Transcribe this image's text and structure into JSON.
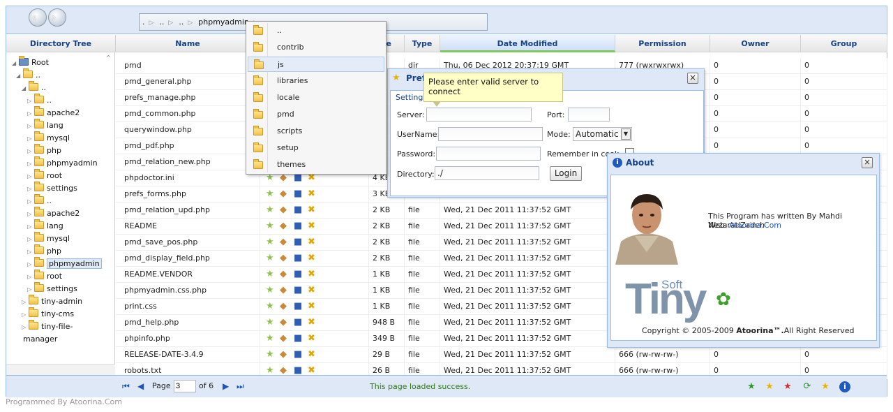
{
  "address": {
    "crumbs": [
      ".",
      "..",
      "..",
      "phpmyadmin"
    ]
  },
  "columns": {
    "tree": "Directory Tree",
    "name": "Name",
    "size": "ze",
    "type": "Type",
    "date": "Date Modified",
    "permission": "Permission",
    "owner": "Owner",
    "group": "Group"
  },
  "tree": [
    {
      "label": "Root",
      "indent": 0
    },
    {
      "label": "..",
      "indent": 1
    },
    {
      "label": "..",
      "indent": 2
    },
    {
      "label": "..",
      "indent": 3
    },
    {
      "label": "apache2",
      "indent": 3
    },
    {
      "label": "lang",
      "indent": 3
    },
    {
      "label": "mysql",
      "indent": 3
    },
    {
      "label": "php",
      "indent": 3
    },
    {
      "label": "phpmyadmin",
      "indent": 3
    },
    {
      "label": "root",
      "indent": 3
    },
    {
      "label": "settings",
      "indent": 3
    },
    {
      "label": "..",
      "indent": 3
    },
    {
      "label": "apache2",
      "indent": 3
    },
    {
      "label": "lang",
      "indent": 3
    },
    {
      "label": "mysql",
      "indent": 3
    },
    {
      "label": "php",
      "indent": 3
    },
    {
      "label": "phpmyadmin",
      "indent": 3,
      "selected": true
    },
    {
      "label": "root",
      "indent": 3
    },
    {
      "label": "settings",
      "indent": 3
    },
    {
      "label": "tiny-admin",
      "indent": 2
    },
    {
      "label": "tiny-cms",
      "indent": 2
    },
    {
      "label": "tiny-file-",
      "indent": 2
    },
    {
      "label": "manager",
      "indent": 1
    }
  ],
  "files": [
    {
      "name": "pmd",
      "size": "",
      "type": "dir",
      "date": "Thu, 06 Dec 2012 20:37:19 GMT",
      "perm": "777 (rwxrwxrwx)",
      "owner": "0",
      "group": "0"
    },
    {
      "name": "pmd_general.php",
      "size": "",
      "type": "",
      "date": "",
      "perm": "",
      "owner": "0",
      "group": "0"
    },
    {
      "name": "prefs_manage.php",
      "size": "",
      "type": "",
      "date": "",
      "perm": "",
      "owner": "0",
      "group": "0"
    },
    {
      "name": "pmd_common.php",
      "size": "",
      "type": "",
      "date": "",
      "perm": "",
      "owner": "0",
      "group": "0"
    },
    {
      "name": "querywindow.php",
      "size": "",
      "type": "",
      "date": "",
      "perm": "",
      "owner": "0",
      "group": "0"
    },
    {
      "name": "pmd_pdf.php",
      "size": "",
      "type": "",
      "date": "",
      "perm": "",
      "owner": "0",
      "group": "0"
    },
    {
      "name": "pmd_relation_new.php",
      "size": "",
      "type": "",
      "date": "",
      "perm": "",
      "owner": "",
      "group": ""
    },
    {
      "name": "phpdoctor.ini",
      "size": "4 KB",
      "type": "",
      "date": "",
      "perm": "",
      "owner": "",
      "group": ""
    },
    {
      "name": "prefs_forms.php",
      "size": "3 KB",
      "type": "",
      "date": "",
      "perm": "",
      "owner": "",
      "group": ""
    },
    {
      "name": "pmd_relation_upd.php",
      "size": "2 KB",
      "type": "file",
      "date": "Wed, 21 Dec 2011 11:37:52 GMT",
      "perm": "",
      "owner": "",
      "group": ""
    },
    {
      "name": "README",
      "size": "2 KB",
      "type": "file",
      "date": "Wed, 21 Dec 2011 11:37:52 GMT",
      "perm": "",
      "owner": "",
      "group": ""
    },
    {
      "name": "pmd_save_pos.php",
      "size": "2 KB",
      "type": "file",
      "date": "Wed, 21 Dec 2011 11:37:52 GMT",
      "perm": "",
      "owner": "",
      "group": ""
    },
    {
      "name": "pmd_display_field.php",
      "size": "2 KB",
      "type": "file",
      "date": "Wed, 21 Dec 2011 11:37:52 GMT",
      "perm": "",
      "owner": "",
      "group": ""
    },
    {
      "name": "README.VENDOR",
      "size": "1 KB",
      "type": "file",
      "date": "Wed, 21 Dec 2011 11:37:52 GMT",
      "perm": "",
      "owner": "",
      "group": ""
    },
    {
      "name": "phpmyadmin.css.php",
      "size": "1 KB",
      "type": "file",
      "date": "Wed, 21 Dec 2011 11:37:52 GMT",
      "perm": "",
      "owner": "",
      "group": ""
    },
    {
      "name": "print.css",
      "size": "1 KB",
      "type": "file",
      "date": "Wed, 21 Dec 2011 11:37:52 GMT",
      "perm": "",
      "owner": "",
      "group": ""
    },
    {
      "name": "pmd_help.php",
      "size": "948 B",
      "type": "file",
      "date": "Wed, 21 Dec 2011 11:37:52 GMT",
      "perm": "",
      "owner": "",
      "group": ""
    },
    {
      "name": "phpinfo.php",
      "size": "349 B",
      "type": "file",
      "date": "Wed, 21 Dec 2011 11:37:52 GMT",
      "perm": "",
      "owner": "",
      "group": ""
    },
    {
      "name": "RELEASE-DATE-3.4.9",
      "size": "29 B",
      "type": "file",
      "date": "Wed, 21 Dec 2011 11:37:52 GMT",
      "perm": "666 (rw-rw-rw-)",
      "owner": "0",
      "group": "0"
    },
    {
      "name": "robots.txt",
      "size": "26 B",
      "type": "file",
      "date": "Wed, 21 Dec 2011 11:37:52 GMT",
      "perm": "666 (rw-rw-rw-)",
      "owner": "0",
      "group": "0"
    }
  ],
  "dropdown": [
    "..",
    "contrib",
    "js",
    "libraries",
    "locale",
    "pmd",
    "scripts",
    "setup",
    "themes"
  ],
  "prefs": {
    "title": "Prefe",
    "legend": "Settings",
    "server_label": "Server:",
    "port_label": "Port:",
    "username_label": "UserName:",
    "mode_label": "Mode:",
    "mode_value": "Automatic",
    "password_label": "Password:",
    "remember_label": "Remember in cook",
    "directory_label": "Directory:",
    "directory_value": "./",
    "login_label": "Login"
  },
  "tooltip": "Please enter valid server to connect",
  "about": {
    "title": "About",
    "line1": "This Program has written By Mahdi NezaratiZadeh",
    "web_label": "Web:",
    "web_link": "Atoorina.Com",
    "logo_soft": "Soft",
    "logo_tiny": "Tiny",
    "copyright_pre": "Copyright © 2005-2009",
    "copyright_brand": "Atoorina™.",
    "copyright_post": "All Right Reserved"
  },
  "footer": {
    "page_label": "Page",
    "page_value": "3",
    "of_label": "of 6",
    "status": "This page loaded success."
  },
  "credit": "Programmed By Atoorina.Com",
  "colors": {
    "accent": "#15428b",
    "panel": "#dfe8f6",
    "border": "#99bbe8",
    "status": "#2a7a10"
  }
}
